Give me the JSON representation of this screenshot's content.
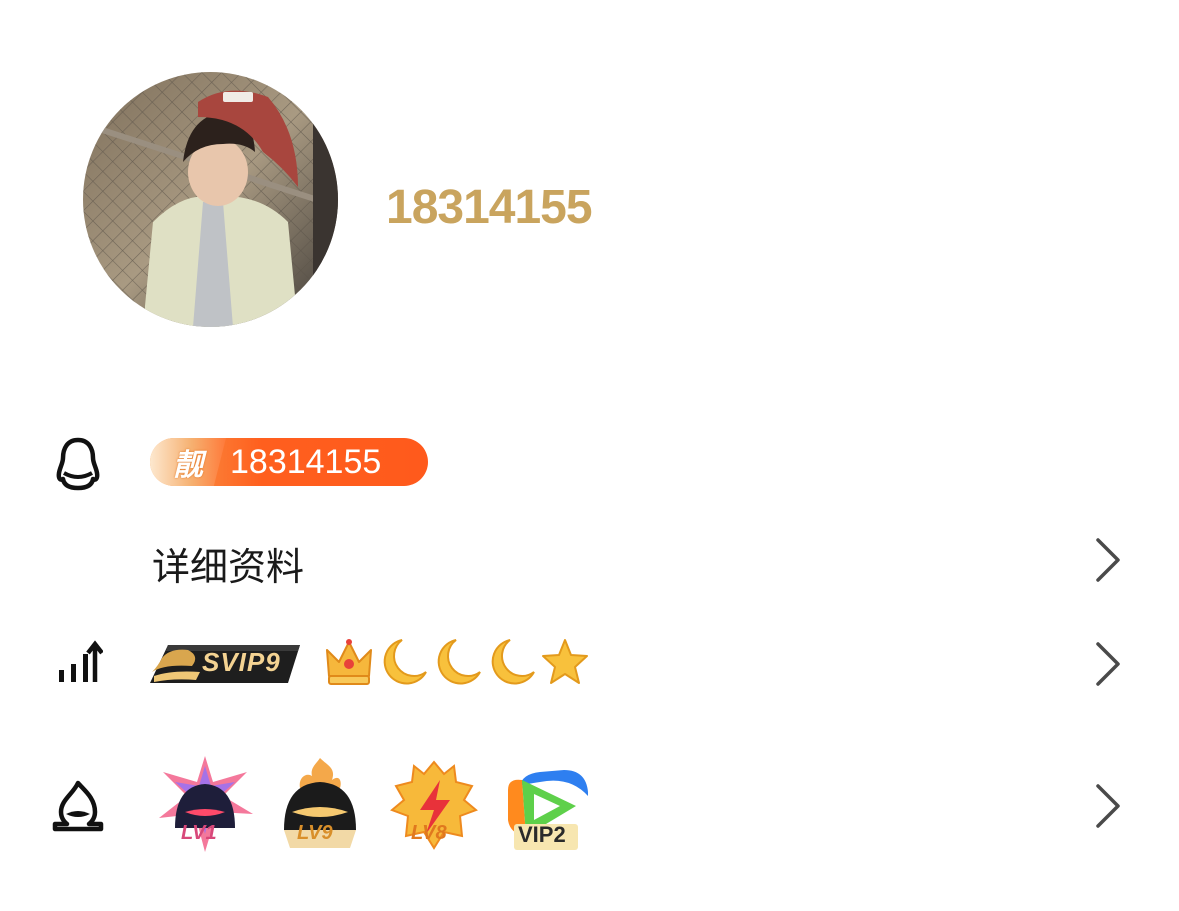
{
  "profile": {
    "nickname": "18314155",
    "avatar_icon": "user-photo"
  },
  "qq_row": {
    "icon": "penguin-icon",
    "pretty_tag": "靓",
    "qq_number": "18314155"
  },
  "detail_row": {
    "label": "详细资料"
  },
  "level_row": {
    "icon": "level-up-icon",
    "svip_label": "SVIP9",
    "level_icons": [
      "crown-icon",
      "moon-icon",
      "moon-icon",
      "moon-icon",
      "star-icon"
    ]
  },
  "badge_row": {
    "icon": "flame-icon",
    "badges": [
      {
        "label": "LV1",
        "icon": "sparkle-flame-medal"
      },
      {
        "label": "LV9",
        "icon": "fire-helmet-medal"
      },
      {
        "label": "LV8",
        "icon": "lightning-medal"
      },
      {
        "label": "VIP2",
        "icon": "tencent-video-medal"
      }
    ]
  },
  "colors": {
    "nickname": "#c9a45e",
    "pretty_badge": "#ff5a1c",
    "chevron": "#4a4a4a"
  }
}
